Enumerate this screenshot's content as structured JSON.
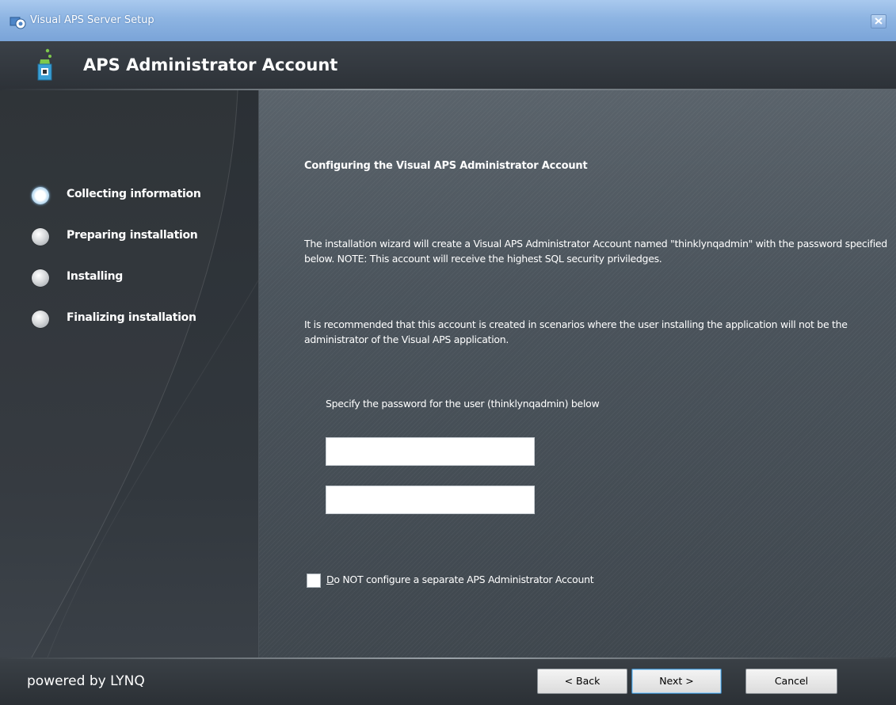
{
  "window": {
    "title": "Visual APS Server Setup",
    "icons": {
      "app": "setup-app-icon",
      "close": "close-icon"
    }
  },
  "header": {
    "title": "APS Administrator Account",
    "icon": "wizard-icon"
  },
  "steps": [
    {
      "label": "Collecting information",
      "state": "active"
    },
    {
      "label": "Preparing installation",
      "state": "pending"
    },
    {
      "label": "Installing",
      "state": "pending"
    },
    {
      "label": "Finalizing installation",
      "state": "pending"
    }
  ],
  "content": {
    "section_title": "Configuring the Visual APS Administrator Account",
    "paragraph1": "The installation wizard will create a Visual APS Administrator Account named \"thinklynqadmin\" with the password specified below.  NOTE: This account will receive the highest SQL security priviledges.",
    "paragraph2": "It is recommended that this account is created in scenarios where the user installing the application will not be the administrator of the Visual APS application.",
    "password_prompt": "Specify the password for the user (thinklynqadmin) below",
    "password_value": "",
    "confirm_password_value": "",
    "checkbox": {
      "mnemonic": "D",
      "label_rest": "o NOT configure a separate APS Administrator Account",
      "checked": false
    }
  },
  "footer": {
    "powered_by": "powered by LYNQ",
    "back_label": "< Back",
    "next_label": "Next >",
    "cancel_label": "Cancel"
  },
  "colors": {
    "titlebar": "#8db4e2",
    "header": "#34393f",
    "left_panel": "#2f353b",
    "right_panel": "#4a535b",
    "active_step": "#7fb5dd",
    "text": "#ffffff"
  }
}
